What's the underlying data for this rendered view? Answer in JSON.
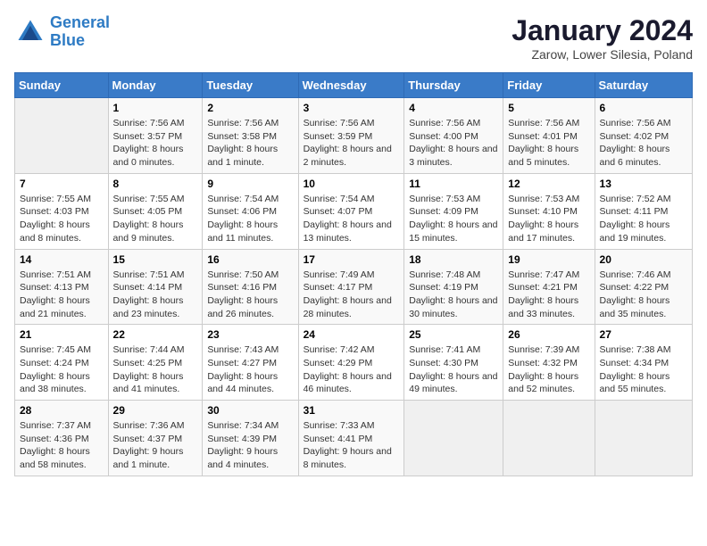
{
  "header": {
    "logo_line1": "General",
    "logo_line2": "Blue",
    "month": "January 2024",
    "location": "Zarow, Lower Silesia, Poland"
  },
  "weekdays": [
    "Sunday",
    "Monday",
    "Tuesday",
    "Wednesday",
    "Thursday",
    "Friday",
    "Saturday"
  ],
  "weeks": [
    [
      {
        "day": "",
        "sunrise": "",
        "sunset": "",
        "daylight": ""
      },
      {
        "day": "1",
        "sunrise": "Sunrise: 7:56 AM",
        "sunset": "Sunset: 3:57 PM",
        "daylight": "Daylight: 8 hours and 0 minutes."
      },
      {
        "day": "2",
        "sunrise": "Sunrise: 7:56 AM",
        "sunset": "Sunset: 3:58 PM",
        "daylight": "Daylight: 8 hours and 1 minute."
      },
      {
        "day": "3",
        "sunrise": "Sunrise: 7:56 AM",
        "sunset": "Sunset: 3:59 PM",
        "daylight": "Daylight: 8 hours and 2 minutes."
      },
      {
        "day": "4",
        "sunrise": "Sunrise: 7:56 AM",
        "sunset": "Sunset: 4:00 PM",
        "daylight": "Daylight: 8 hours and 3 minutes."
      },
      {
        "day": "5",
        "sunrise": "Sunrise: 7:56 AM",
        "sunset": "Sunset: 4:01 PM",
        "daylight": "Daylight: 8 hours and 5 minutes."
      },
      {
        "day": "6",
        "sunrise": "Sunrise: 7:56 AM",
        "sunset": "Sunset: 4:02 PM",
        "daylight": "Daylight: 8 hours and 6 minutes."
      }
    ],
    [
      {
        "day": "7",
        "sunrise": "Sunrise: 7:55 AM",
        "sunset": "Sunset: 4:03 PM",
        "daylight": "Daylight: 8 hours and 8 minutes."
      },
      {
        "day": "8",
        "sunrise": "Sunrise: 7:55 AM",
        "sunset": "Sunset: 4:05 PM",
        "daylight": "Daylight: 8 hours and 9 minutes."
      },
      {
        "day": "9",
        "sunrise": "Sunrise: 7:54 AM",
        "sunset": "Sunset: 4:06 PM",
        "daylight": "Daylight: 8 hours and 11 minutes."
      },
      {
        "day": "10",
        "sunrise": "Sunrise: 7:54 AM",
        "sunset": "Sunset: 4:07 PM",
        "daylight": "Daylight: 8 hours and 13 minutes."
      },
      {
        "day": "11",
        "sunrise": "Sunrise: 7:53 AM",
        "sunset": "Sunset: 4:09 PM",
        "daylight": "Daylight: 8 hours and 15 minutes."
      },
      {
        "day": "12",
        "sunrise": "Sunrise: 7:53 AM",
        "sunset": "Sunset: 4:10 PM",
        "daylight": "Daylight: 8 hours and 17 minutes."
      },
      {
        "day": "13",
        "sunrise": "Sunrise: 7:52 AM",
        "sunset": "Sunset: 4:11 PM",
        "daylight": "Daylight: 8 hours and 19 minutes."
      }
    ],
    [
      {
        "day": "14",
        "sunrise": "Sunrise: 7:51 AM",
        "sunset": "Sunset: 4:13 PM",
        "daylight": "Daylight: 8 hours and 21 minutes."
      },
      {
        "day": "15",
        "sunrise": "Sunrise: 7:51 AM",
        "sunset": "Sunset: 4:14 PM",
        "daylight": "Daylight: 8 hours and 23 minutes."
      },
      {
        "day": "16",
        "sunrise": "Sunrise: 7:50 AM",
        "sunset": "Sunset: 4:16 PM",
        "daylight": "Daylight: 8 hours and 26 minutes."
      },
      {
        "day": "17",
        "sunrise": "Sunrise: 7:49 AM",
        "sunset": "Sunset: 4:17 PM",
        "daylight": "Daylight: 8 hours and 28 minutes."
      },
      {
        "day": "18",
        "sunrise": "Sunrise: 7:48 AM",
        "sunset": "Sunset: 4:19 PM",
        "daylight": "Daylight: 8 hours and 30 minutes."
      },
      {
        "day": "19",
        "sunrise": "Sunrise: 7:47 AM",
        "sunset": "Sunset: 4:21 PM",
        "daylight": "Daylight: 8 hours and 33 minutes."
      },
      {
        "day": "20",
        "sunrise": "Sunrise: 7:46 AM",
        "sunset": "Sunset: 4:22 PM",
        "daylight": "Daylight: 8 hours and 35 minutes."
      }
    ],
    [
      {
        "day": "21",
        "sunrise": "Sunrise: 7:45 AM",
        "sunset": "Sunset: 4:24 PM",
        "daylight": "Daylight: 8 hours and 38 minutes."
      },
      {
        "day": "22",
        "sunrise": "Sunrise: 7:44 AM",
        "sunset": "Sunset: 4:25 PM",
        "daylight": "Daylight: 8 hours and 41 minutes."
      },
      {
        "day": "23",
        "sunrise": "Sunrise: 7:43 AM",
        "sunset": "Sunset: 4:27 PM",
        "daylight": "Daylight: 8 hours and 44 minutes."
      },
      {
        "day": "24",
        "sunrise": "Sunrise: 7:42 AM",
        "sunset": "Sunset: 4:29 PM",
        "daylight": "Daylight: 8 hours and 46 minutes."
      },
      {
        "day": "25",
        "sunrise": "Sunrise: 7:41 AM",
        "sunset": "Sunset: 4:30 PM",
        "daylight": "Daylight: 8 hours and 49 minutes."
      },
      {
        "day": "26",
        "sunrise": "Sunrise: 7:39 AM",
        "sunset": "Sunset: 4:32 PM",
        "daylight": "Daylight: 8 hours and 52 minutes."
      },
      {
        "day": "27",
        "sunrise": "Sunrise: 7:38 AM",
        "sunset": "Sunset: 4:34 PM",
        "daylight": "Daylight: 8 hours and 55 minutes."
      }
    ],
    [
      {
        "day": "28",
        "sunrise": "Sunrise: 7:37 AM",
        "sunset": "Sunset: 4:36 PM",
        "daylight": "Daylight: 8 hours and 58 minutes."
      },
      {
        "day": "29",
        "sunrise": "Sunrise: 7:36 AM",
        "sunset": "Sunset: 4:37 PM",
        "daylight": "Daylight: 9 hours and 1 minute."
      },
      {
        "day": "30",
        "sunrise": "Sunrise: 7:34 AM",
        "sunset": "Sunset: 4:39 PM",
        "daylight": "Daylight: 9 hours and 4 minutes."
      },
      {
        "day": "31",
        "sunrise": "Sunrise: 7:33 AM",
        "sunset": "Sunset: 4:41 PM",
        "daylight": "Daylight: 9 hours and 8 minutes."
      },
      {
        "day": "",
        "sunrise": "",
        "sunset": "",
        "daylight": ""
      },
      {
        "day": "",
        "sunrise": "",
        "sunset": "",
        "daylight": ""
      },
      {
        "day": "",
        "sunrise": "",
        "sunset": "",
        "daylight": ""
      }
    ]
  ]
}
